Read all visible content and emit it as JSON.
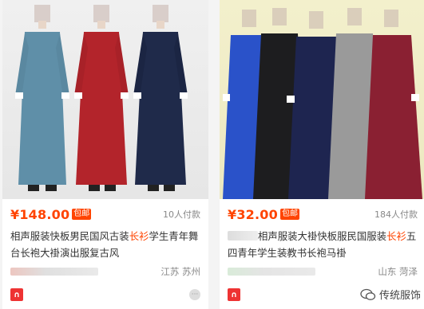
{
  "products": [
    {
      "price": "¥148.00",
      "badge": "包邮",
      "sold": "10人付款",
      "title_pre": "相声服装快板男民国风古装",
      "title_hl": "长衫",
      "title_post": "学生青年舞台长袍大褂演出服复古风",
      "location": "江苏 苏州",
      "colors": [
        "#5f8fa8",
        "#b3242b",
        "#1f2a4a"
      ]
    },
    {
      "price": "¥32.00",
      "badge": "包邮",
      "sold": "184人付款",
      "title_pre": "相声服装大褂快板服民国服装",
      "title_hl": "长衫",
      "title_post": "五四青年学生装教书长袍马褂",
      "location": "山东 菏泽",
      "colors": [
        "#2a52c9",
        "#1d1d1f",
        "#1e2550",
        "#9a9a9a",
        "#8a2032"
      ]
    }
  ],
  "watermark": "传统服饰"
}
